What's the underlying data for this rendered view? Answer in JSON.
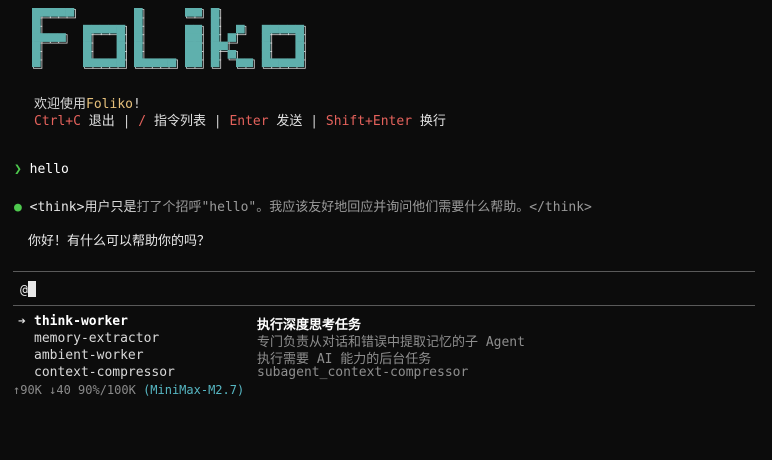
{
  "banner": {
    "text": "FOLIKO",
    "fill": "#5fb0ad",
    "outline": "#d8d8d8"
  },
  "welcome": {
    "prefix": "欢迎使用",
    "brand": "Foliko",
    "suffix": "!"
  },
  "help": {
    "items": [
      {
        "key": "Ctrl+C",
        "desc": "退出"
      },
      {
        "key": "/",
        "desc": "指令列表"
      },
      {
        "key": "Enter",
        "desc": "发送"
      },
      {
        "key": "Shift+Enter",
        "desc": "换行"
      }
    ],
    "separator": "|"
  },
  "conversation": {
    "user_prompt_symbol": "❯",
    "user_message": "hello",
    "bullet": "●",
    "think_open": "<think>",
    "think_lead": "用户只是",
    "think_body": "打了个招呼\"hello\"。我应该友好地回应并询问他们需要什么帮助。",
    "think_close": "</think>",
    "assistant_reply": "你好！有什么可以帮助你的吗？"
  },
  "input": {
    "value": "@"
  },
  "suggestions": {
    "selected_marker": "➔",
    "items": [
      {
        "name": "think-worker",
        "desc": "执行深度思考任务",
        "selected": true
      },
      {
        "name": "memory-extractor",
        "desc": "专门负责从对话和错误中提取记忆的子 Agent",
        "selected": false
      },
      {
        "name": "ambient-worker",
        "desc": "执行需要 AI 能力的后台任务",
        "selected": false
      },
      {
        "name": "context-compressor",
        "desc": "subagent_context-compressor",
        "selected": false
      }
    ]
  },
  "status": {
    "usage": "↑90K ↓40 90%/100K",
    "model": "(MiniMax-M2.7)"
  },
  "colors": {
    "background": "#0c0c0c",
    "accent_green": "#4ec94e",
    "key_red": "#e5625c",
    "brand_yellow": "#e6c07b",
    "model_cyan": "#56b6c2"
  }
}
